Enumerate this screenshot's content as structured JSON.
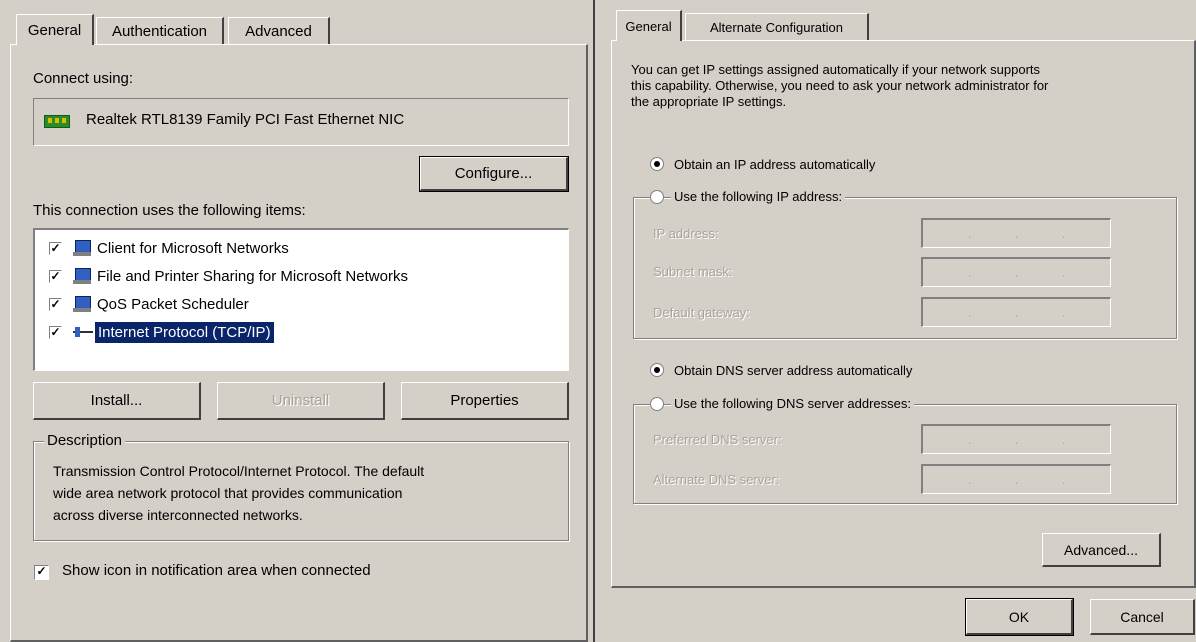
{
  "left": {
    "tabs": [
      "General",
      "Authentication",
      "Advanced"
    ],
    "connect_using_label": "Connect using:",
    "adapter_name": "Realtek RTL8139 Family PCI Fast Ethernet NIC",
    "configure_button": "Configure...",
    "items_label": "This connection uses the following items:",
    "items": [
      {
        "label": "Client for Microsoft Networks",
        "checked": true
      },
      {
        "label": "File and Printer Sharing for Microsoft Networks",
        "checked": true
      },
      {
        "label": "QoS Packet Scheduler",
        "checked": true
      },
      {
        "label": "Internet Protocol (TCP/IP)",
        "checked": true,
        "selected": true
      }
    ],
    "install_button": "Install...",
    "uninstall_button": "Uninstall",
    "properties_button": "Properties",
    "description_legend": "Description",
    "description_text": [
      "Transmission Control Protocol/Internet Protocol. The default",
      "wide area network protocol that provides communication",
      "across diverse interconnected networks."
    ],
    "show_icon_label": "Show icon in notification area when connected"
  },
  "right": {
    "tabs": [
      "General",
      "Alternate Configuration"
    ],
    "intro_text": [
      "You can get IP settings assigned automatically if your network supports",
      "this capability. Otherwise, you need to ask your network administrator for",
      "the appropriate IP settings."
    ],
    "obtain_ip_auto": "Obtain an IP address automatically",
    "use_following_ip": "Use the following IP address:",
    "ip_address_label": "IP address:",
    "subnet_mask_label": "Subnet mask:",
    "default_gateway_label": "Default gateway:",
    "obtain_dns_auto": "Obtain DNS server address automatically",
    "use_following_dns": "Use the following DNS server addresses:",
    "preferred_dns_label": "Preferred DNS server:",
    "alternate_dns_label": "Alternate DNS server:",
    "advanced_button": "Advanced...",
    "ok_button": "OK",
    "cancel_button": "Cancel"
  },
  "colors": {
    "dialog_bg": "#d4d0c8",
    "selection": "#0a246a",
    "disabled_text": "#a8a49c"
  }
}
